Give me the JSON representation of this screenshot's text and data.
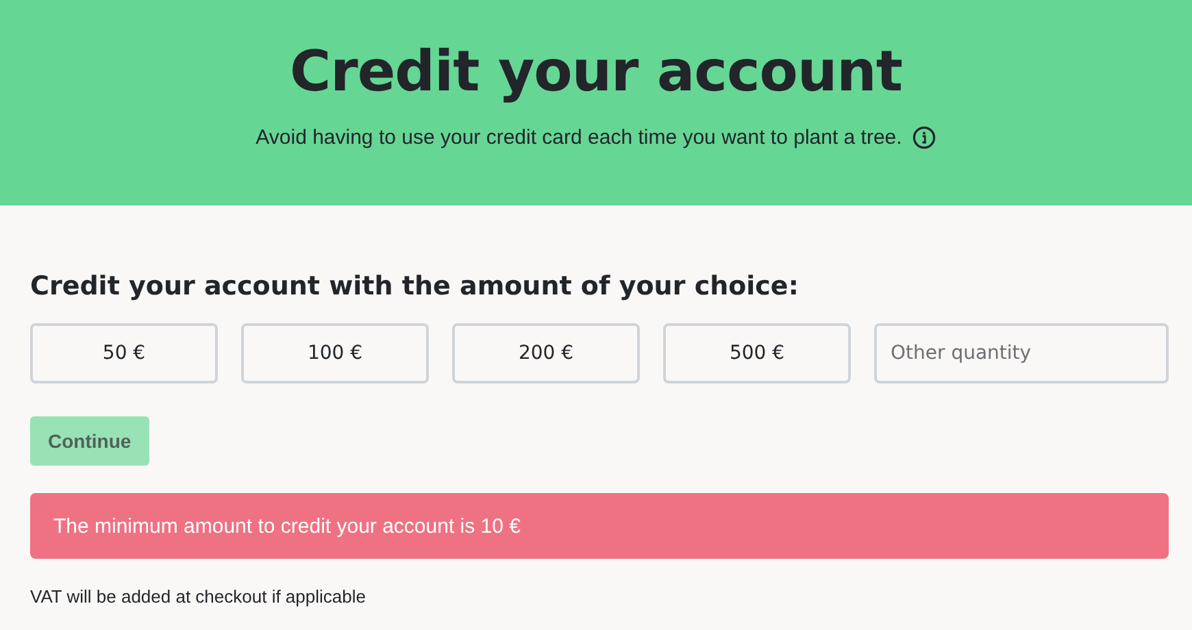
{
  "header": {
    "title": "Credit your account",
    "subtitle": "Avoid having to use your credit card each time you want to plant a tree."
  },
  "form": {
    "heading": "Credit your account with the amount of your choice:",
    "amounts": [
      {
        "label": "50 €",
        "selected": false
      },
      {
        "label": "100 €",
        "selected": false
      },
      {
        "label": "200 €",
        "selected": false
      },
      {
        "label": "500 €",
        "selected": false
      }
    ],
    "other": {
      "placeholder": "Other quantity"
    },
    "continue": {
      "label": "Continue",
      "disabled": true
    },
    "alert": "The minimum amount to credit your account is 10 €",
    "note": "VAT will be added at checkout if applicable"
  }
}
